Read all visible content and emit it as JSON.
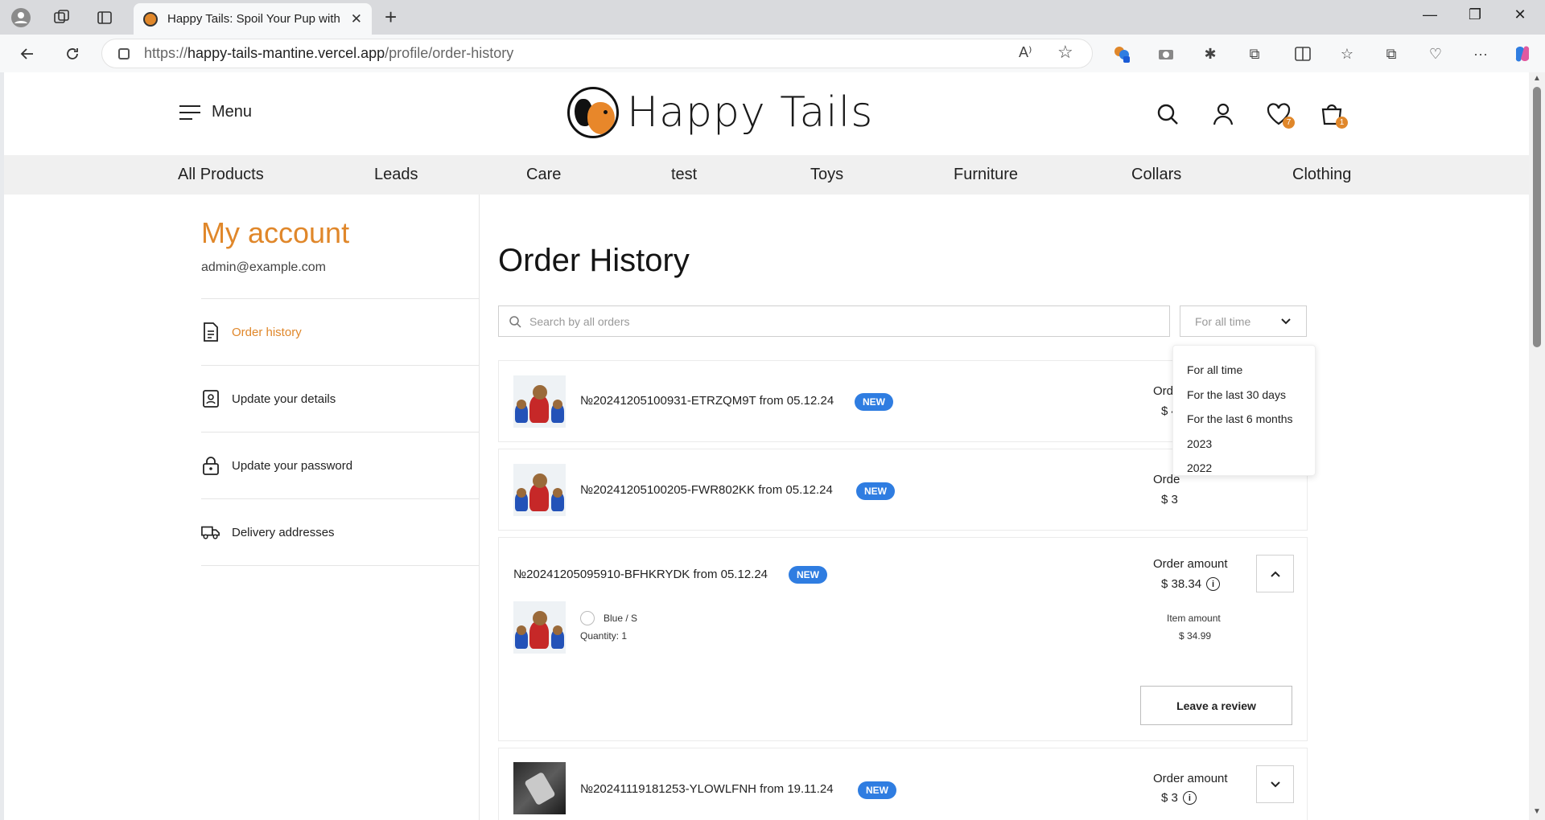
{
  "browser": {
    "tab_title": "Happy Tails: Spoil Your Pup with Love",
    "url_domain": "happy-tails-mantine.vercel.app",
    "url_path": "/profile/order-history",
    "url_scheme": "https://"
  },
  "header": {
    "menu_label": "Menu",
    "logo_text": "Happy Tails",
    "wishlist_count": "7",
    "cart_count": "1"
  },
  "categories": [
    "All Products",
    "Leads",
    "Care",
    "test",
    "Toys",
    "Furniture",
    "Collars",
    "Clothing"
  ],
  "sidebar": {
    "title": "My account",
    "email": "admin@example.com",
    "items": [
      {
        "label": "Order history",
        "icon": "document-icon"
      },
      {
        "label": "Update your details",
        "icon": "profile-card-icon"
      },
      {
        "label": "Update your password",
        "icon": "lock-icon"
      },
      {
        "label": "Delivery addresses",
        "icon": "truck-icon"
      }
    ]
  },
  "main": {
    "title": "Order History",
    "search_placeholder": "Search by all orders",
    "period_selected": "For all time",
    "period_options": [
      "For all time",
      "For the last 30 days",
      "For the last 6 months",
      "2023",
      "2022"
    ]
  },
  "orders": [
    {
      "number": "№20241205100931-ETRZQM9T from 05.12.24",
      "status": "NEW",
      "amount_label": "Orde",
      "amount": "$ 4"
    },
    {
      "number": "№20241205100205-FWR802KK from 05.12.24",
      "status": "NEW",
      "amount_label": "Orde",
      "amount": "$ 3"
    },
    {
      "number": "№20241205095910-BFHKRYDK from 05.12.24",
      "status": "NEW",
      "amount_label": "Order amount",
      "amount": "$ 38.34",
      "item": {
        "variant": "Blue / S",
        "quantity": "Quantity: 1",
        "item_amount_label": "Item amount",
        "item_amount": "$ 34.99"
      },
      "review_label": "Leave a review"
    },
    {
      "number": "№20241119181253-YLOWLFNH from 19.11.24",
      "status": "NEW",
      "amount_label": "Order amount",
      "amount": "$ 3"
    }
  ],
  "colors": {
    "accent": "#e0872a",
    "badge": "#2f7de1"
  }
}
